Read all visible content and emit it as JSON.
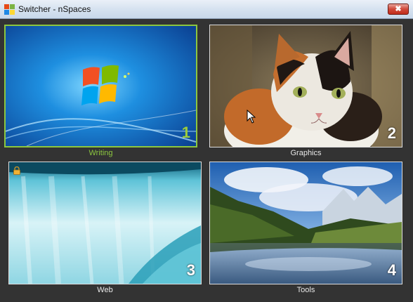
{
  "window": {
    "title": "Switcher - nSpaces",
    "close_label": "✖"
  },
  "spaces": [
    {
      "label": "Writing",
      "number": "1",
      "active": true
    },
    {
      "label": "Graphics",
      "number": "2",
      "active": false
    },
    {
      "label": "Web",
      "number": "3",
      "active": false,
      "locked": true
    },
    {
      "label": "Tools",
      "number": "4",
      "active": false
    }
  ],
  "colors": {
    "accent": "#8cc63f",
    "background": "#333333"
  }
}
